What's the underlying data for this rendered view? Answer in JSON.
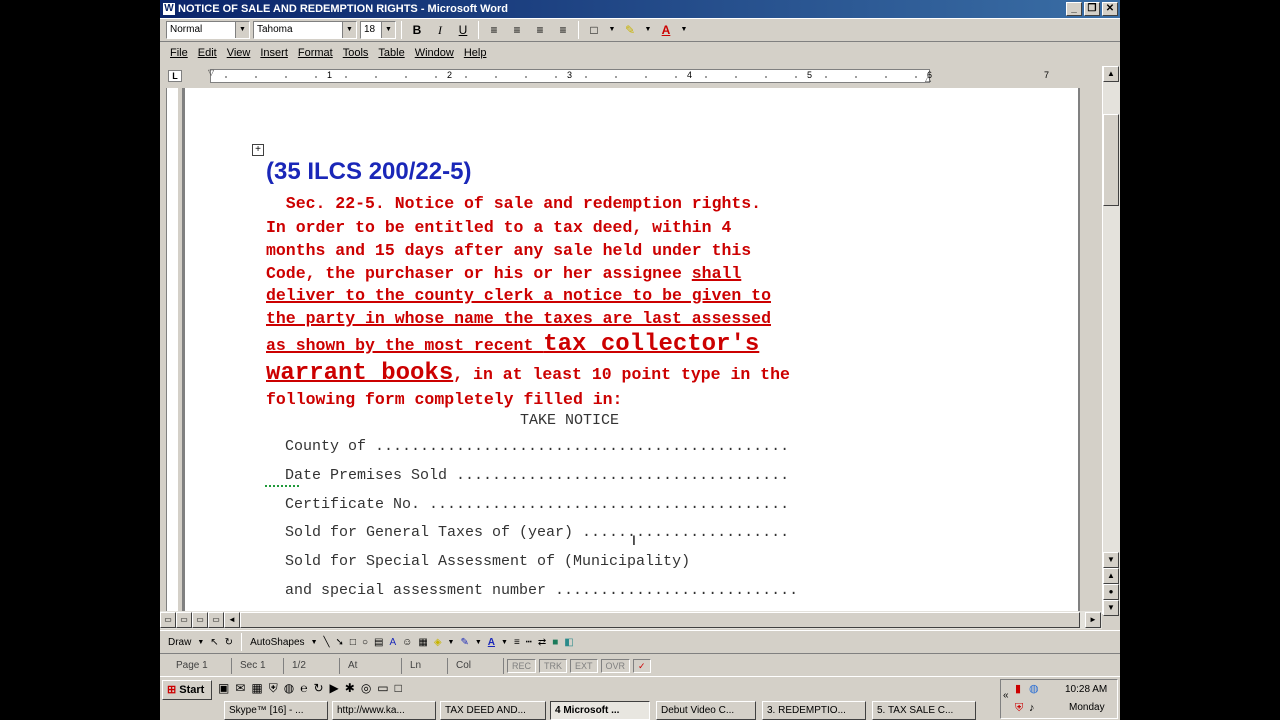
{
  "window": {
    "title": "NOTICE OF SALE AND REDEMPTION RIGHTS - Microsoft Word"
  },
  "formatting": {
    "style": "Normal",
    "font": "Tahoma",
    "size": "18"
  },
  "menu": [
    "File",
    "Edit",
    "View",
    "Insert",
    "Format",
    "Tools",
    "Table",
    "Window",
    "Help"
  ],
  "ruler": {
    "numbers": [
      "1",
      "2",
      "3",
      "4",
      "5",
      "6",
      "7"
    ]
  },
  "document": {
    "heading": "(35 ILCS 200/22-5)",
    "lines": [
      "  Sec. 22-5. Notice of sale and redemption rights.",
      "In order to be entitled to a tax deed, within 4",
      "months and 15 days after any sale held under this",
      "Code, the purchaser or his or her assignee "
    ],
    "shall": "shall",
    "line5": "deliver to the county clerk a notice to be given to",
    "line6": "the party in whose name the taxes are last assessed",
    "line7a": "as shown by the most recent ",
    "line7b": "tax collector's",
    "line8a": "warrant books",
    "line8b": ", in at least 10 point type in the",
    "line9": "following form completely filled in:",
    "take_notice": "TAKE NOTICE",
    "form": [
      "County of ..............................................",
      "Date Premises Sold .....................................",
      "Certificate No. ........................................",
      "Sold for General Taxes of (year) .......................",
      "Sold for Special Assessment of (Municipality)",
      "and special assessment number ..........................."
    ]
  },
  "drawing": {
    "draw": "Draw",
    "autoshapes": "AutoShapes"
  },
  "status": {
    "page": "Page 1",
    "sec": "Sec 1",
    "pages": "1/2",
    "at": "At",
    "ln": "Ln",
    "col": "Col",
    "flags": [
      "REC",
      "TRK",
      "EXT",
      "OVR"
    ]
  },
  "taskbar": {
    "start": "Start",
    "tasks": [
      "Skype™ [16] - ...",
      "http://www.ka...",
      "TAX DEED AND...",
      "4 Microsoft ...",
      "Debut Video C...",
      "3. REDEMPTIO...",
      "5. TAX SALE C..."
    ],
    "clock": "10:28 AM",
    "day": "Monday"
  }
}
